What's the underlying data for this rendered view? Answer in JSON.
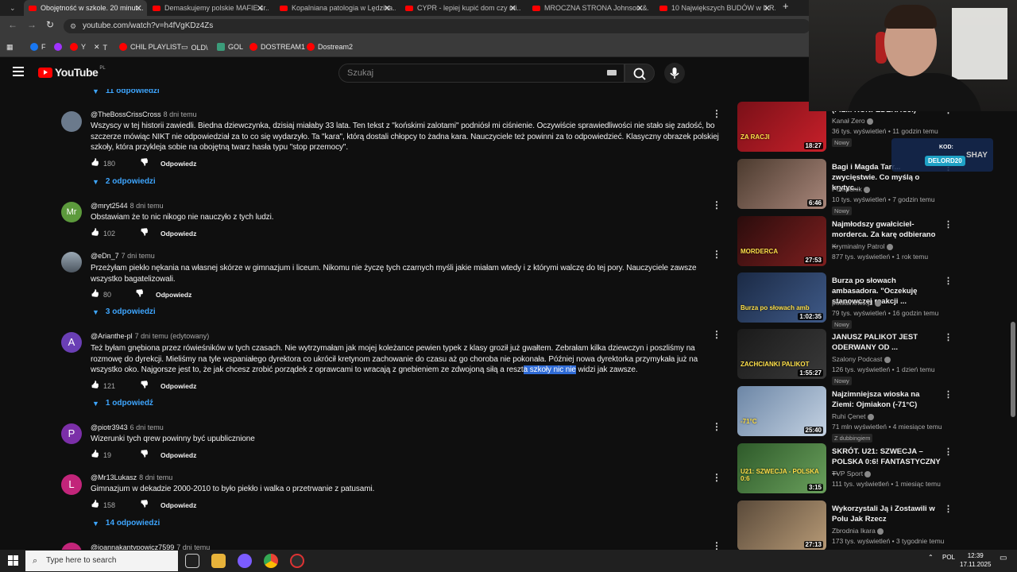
{
  "tabs": [
    {
      "title": "Obojętność w szkole. 20 minut...",
      "active": true
    },
    {
      "title": "Demaskujemy polskie MAFIE śr..."
    },
    {
      "title": "Kopalniana patologia w Lędzina..."
    },
    {
      "title": "CYPR - lepiej kupić dom czy mi..."
    },
    {
      "title": "MROCZNA STRONA Johnson &..."
    },
    {
      "title": "10 Największych BUDÓW w II R..."
    }
  ],
  "address": "youtube.com/watch?v=h4fVgKDz4Zs",
  "bookmarks": [
    "F",
    "Y",
    "T",
    "CHIL PLAYLIST",
    "OLD\\",
    "GOL",
    "DOSTREAM1",
    "Dostream2"
  ],
  "youtube": {
    "logo": "YouTube",
    "region": "PL",
    "search_placeholder": "Szukaj"
  },
  "comments": [
    {
      "kind": "replies",
      "label": "11 odpowiedzi"
    },
    {
      "author": "@TheBossCrissCross",
      "time": "8 dni temu",
      "text": "Wszyscy w tej historii zawiedli. Biedna dziewczynka, dzisiaj miałaby 33 lata. Ten tekst z \"końskimi zalotami\" podniósł mi ciśnienie. Oczywiście sprawiedliwości nie stało się zadość, bo szczerze mówiąc NIKT nie odpowiedział za to co się wydarzyło. Ta \"kara\", którą dostali chłopcy to żadna kara. Nauczyciele też powinni za to odpowiedzieć. Klasyczny obrazek polskiej szkoły, która przykleja sobie na obojętną twarz hasła typu \"stop przemocy\".",
      "likes": "180",
      "reply": "Odpowiedz",
      "replies": "2 odpowiedzi",
      "avatar_color": "#6b7a8c",
      "initial": ""
    },
    {
      "author": "@mryt2544",
      "time": "8 dni temu",
      "text": "Obstawiam że to nic nikogo nie nauczyło z tych ludzi.",
      "likes": "102",
      "reply": "Odpowiedz",
      "avatar_color": "#5c9a3c",
      "initial": "Mr"
    },
    {
      "author": "@eDn_7",
      "time": "7 dni temu",
      "text": "Przeżyłam piekło nękania na własnej skórze w gimnazjum i liceum. Nikomu nie życzę tych czarnych myśli jakie miałam wtedy i z którymi walczę do tej pory. Nauczyciele zawsze wszystko bagatelizowali.",
      "likes": "80",
      "reply": "Odpowiedz",
      "replies": "3 odpowiedzi",
      "avatar_color": "#6f7c86",
      "initial": ""
    },
    {
      "author": "@Arianthe-pl",
      "time": "7 dni temu (edytowany)",
      "text_a": "Też byłam gnębiona przez rówieśników w tych czasach. Nie wytrzymałam jak mojej koleżance pewien typek z klasy groził już gwałtem. Zebrałam kilka dziewczyn i poszliśmy na rozmowę do dyrekcji. Mieliśmy na tyle wspaniałego dyrektora co ukrócił kretynom zachowanie do czasu aż go choroba nie pokonała. Później nowa dyrektorka przymykała już na wszystko oko. Najgorsze jest to, że jak chcesz zrobić porządek z oprawcami to wracają  z gnebieniem ze zdwojoną siłą a reszt",
      "text_hl": "a szkoły nic nie",
      "text_b": " widzi jak zawsze.",
      "likes": "121",
      "reply": "Odpowiedz",
      "replies": "1 odpowiedź",
      "avatar_color": "#6a3fb5",
      "initial": "A"
    },
    {
      "author": "@piotr3943",
      "time": "6 dni temu",
      "text": "Wizerunki tych qrew powinny być upublicznione",
      "likes": "19",
      "reply": "Odpowiedz",
      "avatar_color": "#7b2fa8",
      "initial": "P"
    },
    {
      "author": "@Mr13Lukasz",
      "time": "8 dni temu",
      "text": "Gimnazjum w dekadzie 2000-2010 to było piekło i walka o przetrwanie z patusami.",
      "likes": "158",
      "reply": "Odpowiedz",
      "replies": "14 odpowiedzi",
      "avatar_color": "#c2257a",
      "initial": "L"
    },
    {
      "author": "@joannakantypowicz7599",
      "time": "7 dni temu"
    }
  ],
  "sidebar": [
    {
      "title": "(FILM KONFEDERACJI)",
      "channel": "Kanał Zero",
      "meta": "36 tys. wyświetleń • 11 godzin temu",
      "badge": "Nowy",
      "duration": "18:27",
      "thumb_text": "ZA RACJI",
      "thumb_colors": [
        "#7a1018",
        "#c8202a"
      ]
    },
    {
      "title": "Bagi i Magda Tarr... zwycięstwie. Co myślą o krytyc...",
      "channel": "Pomponik",
      "meta": "10 tys. wyświetleń • 7 godzin temu",
      "badge": "Nowy",
      "duration": "6:46",
      "thumb_text": "",
      "thumb_colors": [
        "#4b3a2e",
        "#a8867a"
      ]
    },
    {
      "title": "Najmłodszy gwałciciel-morderca. Za karę odbierano ...",
      "channel": "Kryminalny Patrol",
      "meta": "877 tys. wyświetleń • 1 rok temu",
      "duration": "27:53",
      "thumb_text": "MORDERCA",
      "thumb_colors": [
        "#2a0c0c",
        "#7e1f1f"
      ]
    },
    {
      "title": "Burza po słowach ambasadora. \"Oczekuję stanowczej reakcji ...",
      "channel": "polsatnews.pl",
      "meta": "79 tys. wyświetleń • 16 godzin temu",
      "badge": "Nowy",
      "duration": "1:02:35",
      "thumb_text": "Burza po słowach amb",
      "thumb_colors": [
        "#1b2a45",
        "#3f5a88"
      ]
    },
    {
      "title": "JANUSZ PALIKOT JEST ODERWANY OD ...",
      "channel": "Szalony Podcast",
      "meta": "126 tys. wyświetleń • 1 dzień temu",
      "badge": "Nowy",
      "duration": "1:55:27",
      "thumb_text": "ZACHCIANKI PALIKOT",
      "thumb_colors": [
        "#1a1a1a",
        "#3a3a3a"
      ]
    },
    {
      "title": "Najzimniejsza wioska na Ziemi: Ojmiakon (-71°C)",
      "channel": "Ruhi Çenet",
      "meta": "71 mln wyświetleń • 4 miesiące temu",
      "badge": "Z dubbingiem",
      "duration": "25:40",
      "thumb_text": "-71°C",
      "thumb_colors": [
        "#6c86a6",
        "#c4d2e2"
      ]
    },
    {
      "title": "SKRÓT. U21: SZWECJA – POLSKA 0:6! FANTASTYCZNY ...",
      "channel": "TVP Sport",
      "meta": "111 tys. wyświetleń • 1 miesiąc temu",
      "duration": "3:15",
      "thumb_text": "U21: SZWECJA - POLSKA 0:6",
      "thumb_colors": [
        "#2e5a2a",
        "#6aa05c"
      ]
    },
    {
      "title": "Wykorzystali Ją i Zostawili w Polu Jak Rzecz",
      "channel": "Zbrodnia Ikara",
      "meta": "173 tys. wyświetleń • 3 tygodnie temu",
      "duration": "27:13",
      "thumb_text": "",
      "thumb_colors": [
        "#5a4a3a",
        "#b79a76"
      ]
    }
  ],
  "overlay": {
    "label": "KOD:",
    "code": "DELORD20",
    "brand": "SHAY"
  },
  "taskbar": {
    "search_placeholder": "Type here to search",
    "lang": "POL",
    "time": "12:39",
    "date": "17.11.2025"
  }
}
